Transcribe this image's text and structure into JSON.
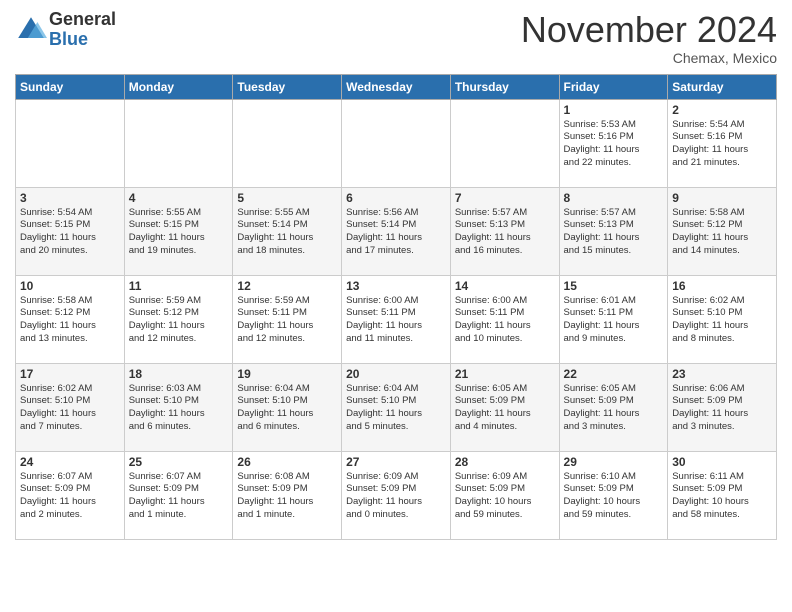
{
  "logo": {
    "general": "General",
    "blue": "Blue"
  },
  "header": {
    "month": "November 2024",
    "location": "Chemax, Mexico"
  },
  "days_of_week": [
    "Sunday",
    "Monday",
    "Tuesday",
    "Wednesday",
    "Thursday",
    "Friday",
    "Saturday"
  ],
  "weeks": [
    [
      {
        "day": "",
        "info": ""
      },
      {
        "day": "",
        "info": ""
      },
      {
        "day": "",
        "info": ""
      },
      {
        "day": "",
        "info": ""
      },
      {
        "day": "",
        "info": ""
      },
      {
        "day": "1",
        "info": "Sunrise: 5:53 AM\nSunset: 5:16 PM\nDaylight: 11 hours\nand 22 minutes."
      },
      {
        "day": "2",
        "info": "Sunrise: 5:54 AM\nSunset: 5:16 PM\nDaylight: 11 hours\nand 21 minutes."
      }
    ],
    [
      {
        "day": "3",
        "info": "Sunrise: 5:54 AM\nSunset: 5:15 PM\nDaylight: 11 hours\nand 20 minutes."
      },
      {
        "day": "4",
        "info": "Sunrise: 5:55 AM\nSunset: 5:15 PM\nDaylight: 11 hours\nand 19 minutes."
      },
      {
        "day": "5",
        "info": "Sunrise: 5:55 AM\nSunset: 5:14 PM\nDaylight: 11 hours\nand 18 minutes."
      },
      {
        "day": "6",
        "info": "Sunrise: 5:56 AM\nSunset: 5:14 PM\nDaylight: 11 hours\nand 17 minutes."
      },
      {
        "day": "7",
        "info": "Sunrise: 5:57 AM\nSunset: 5:13 PM\nDaylight: 11 hours\nand 16 minutes."
      },
      {
        "day": "8",
        "info": "Sunrise: 5:57 AM\nSunset: 5:13 PM\nDaylight: 11 hours\nand 15 minutes."
      },
      {
        "day": "9",
        "info": "Sunrise: 5:58 AM\nSunset: 5:12 PM\nDaylight: 11 hours\nand 14 minutes."
      }
    ],
    [
      {
        "day": "10",
        "info": "Sunrise: 5:58 AM\nSunset: 5:12 PM\nDaylight: 11 hours\nand 13 minutes."
      },
      {
        "day": "11",
        "info": "Sunrise: 5:59 AM\nSunset: 5:12 PM\nDaylight: 11 hours\nand 12 minutes."
      },
      {
        "day": "12",
        "info": "Sunrise: 5:59 AM\nSunset: 5:11 PM\nDaylight: 11 hours\nand 12 minutes."
      },
      {
        "day": "13",
        "info": "Sunrise: 6:00 AM\nSunset: 5:11 PM\nDaylight: 11 hours\nand 11 minutes."
      },
      {
        "day": "14",
        "info": "Sunrise: 6:00 AM\nSunset: 5:11 PM\nDaylight: 11 hours\nand 10 minutes."
      },
      {
        "day": "15",
        "info": "Sunrise: 6:01 AM\nSunset: 5:11 PM\nDaylight: 11 hours\nand 9 minutes."
      },
      {
        "day": "16",
        "info": "Sunrise: 6:02 AM\nSunset: 5:10 PM\nDaylight: 11 hours\nand 8 minutes."
      }
    ],
    [
      {
        "day": "17",
        "info": "Sunrise: 6:02 AM\nSunset: 5:10 PM\nDaylight: 11 hours\nand 7 minutes."
      },
      {
        "day": "18",
        "info": "Sunrise: 6:03 AM\nSunset: 5:10 PM\nDaylight: 11 hours\nand 6 minutes."
      },
      {
        "day": "19",
        "info": "Sunrise: 6:04 AM\nSunset: 5:10 PM\nDaylight: 11 hours\nand 6 minutes."
      },
      {
        "day": "20",
        "info": "Sunrise: 6:04 AM\nSunset: 5:10 PM\nDaylight: 11 hours\nand 5 minutes."
      },
      {
        "day": "21",
        "info": "Sunrise: 6:05 AM\nSunset: 5:09 PM\nDaylight: 11 hours\nand 4 minutes."
      },
      {
        "day": "22",
        "info": "Sunrise: 6:05 AM\nSunset: 5:09 PM\nDaylight: 11 hours\nand 3 minutes."
      },
      {
        "day": "23",
        "info": "Sunrise: 6:06 AM\nSunset: 5:09 PM\nDaylight: 11 hours\nand 3 minutes."
      }
    ],
    [
      {
        "day": "24",
        "info": "Sunrise: 6:07 AM\nSunset: 5:09 PM\nDaylight: 11 hours\nand 2 minutes."
      },
      {
        "day": "25",
        "info": "Sunrise: 6:07 AM\nSunset: 5:09 PM\nDaylight: 11 hours\nand 1 minute."
      },
      {
        "day": "26",
        "info": "Sunrise: 6:08 AM\nSunset: 5:09 PM\nDaylight: 11 hours\nand 1 minute."
      },
      {
        "day": "27",
        "info": "Sunrise: 6:09 AM\nSunset: 5:09 PM\nDaylight: 11 hours\nand 0 minutes."
      },
      {
        "day": "28",
        "info": "Sunrise: 6:09 AM\nSunset: 5:09 PM\nDaylight: 10 hours\nand 59 minutes."
      },
      {
        "day": "29",
        "info": "Sunrise: 6:10 AM\nSunset: 5:09 PM\nDaylight: 10 hours\nand 59 minutes."
      },
      {
        "day": "30",
        "info": "Sunrise: 6:11 AM\nSunset: 5:09 PM\nDaylight: 10 hours\nand 58 minutes."
      }
    ]
  ]
}
